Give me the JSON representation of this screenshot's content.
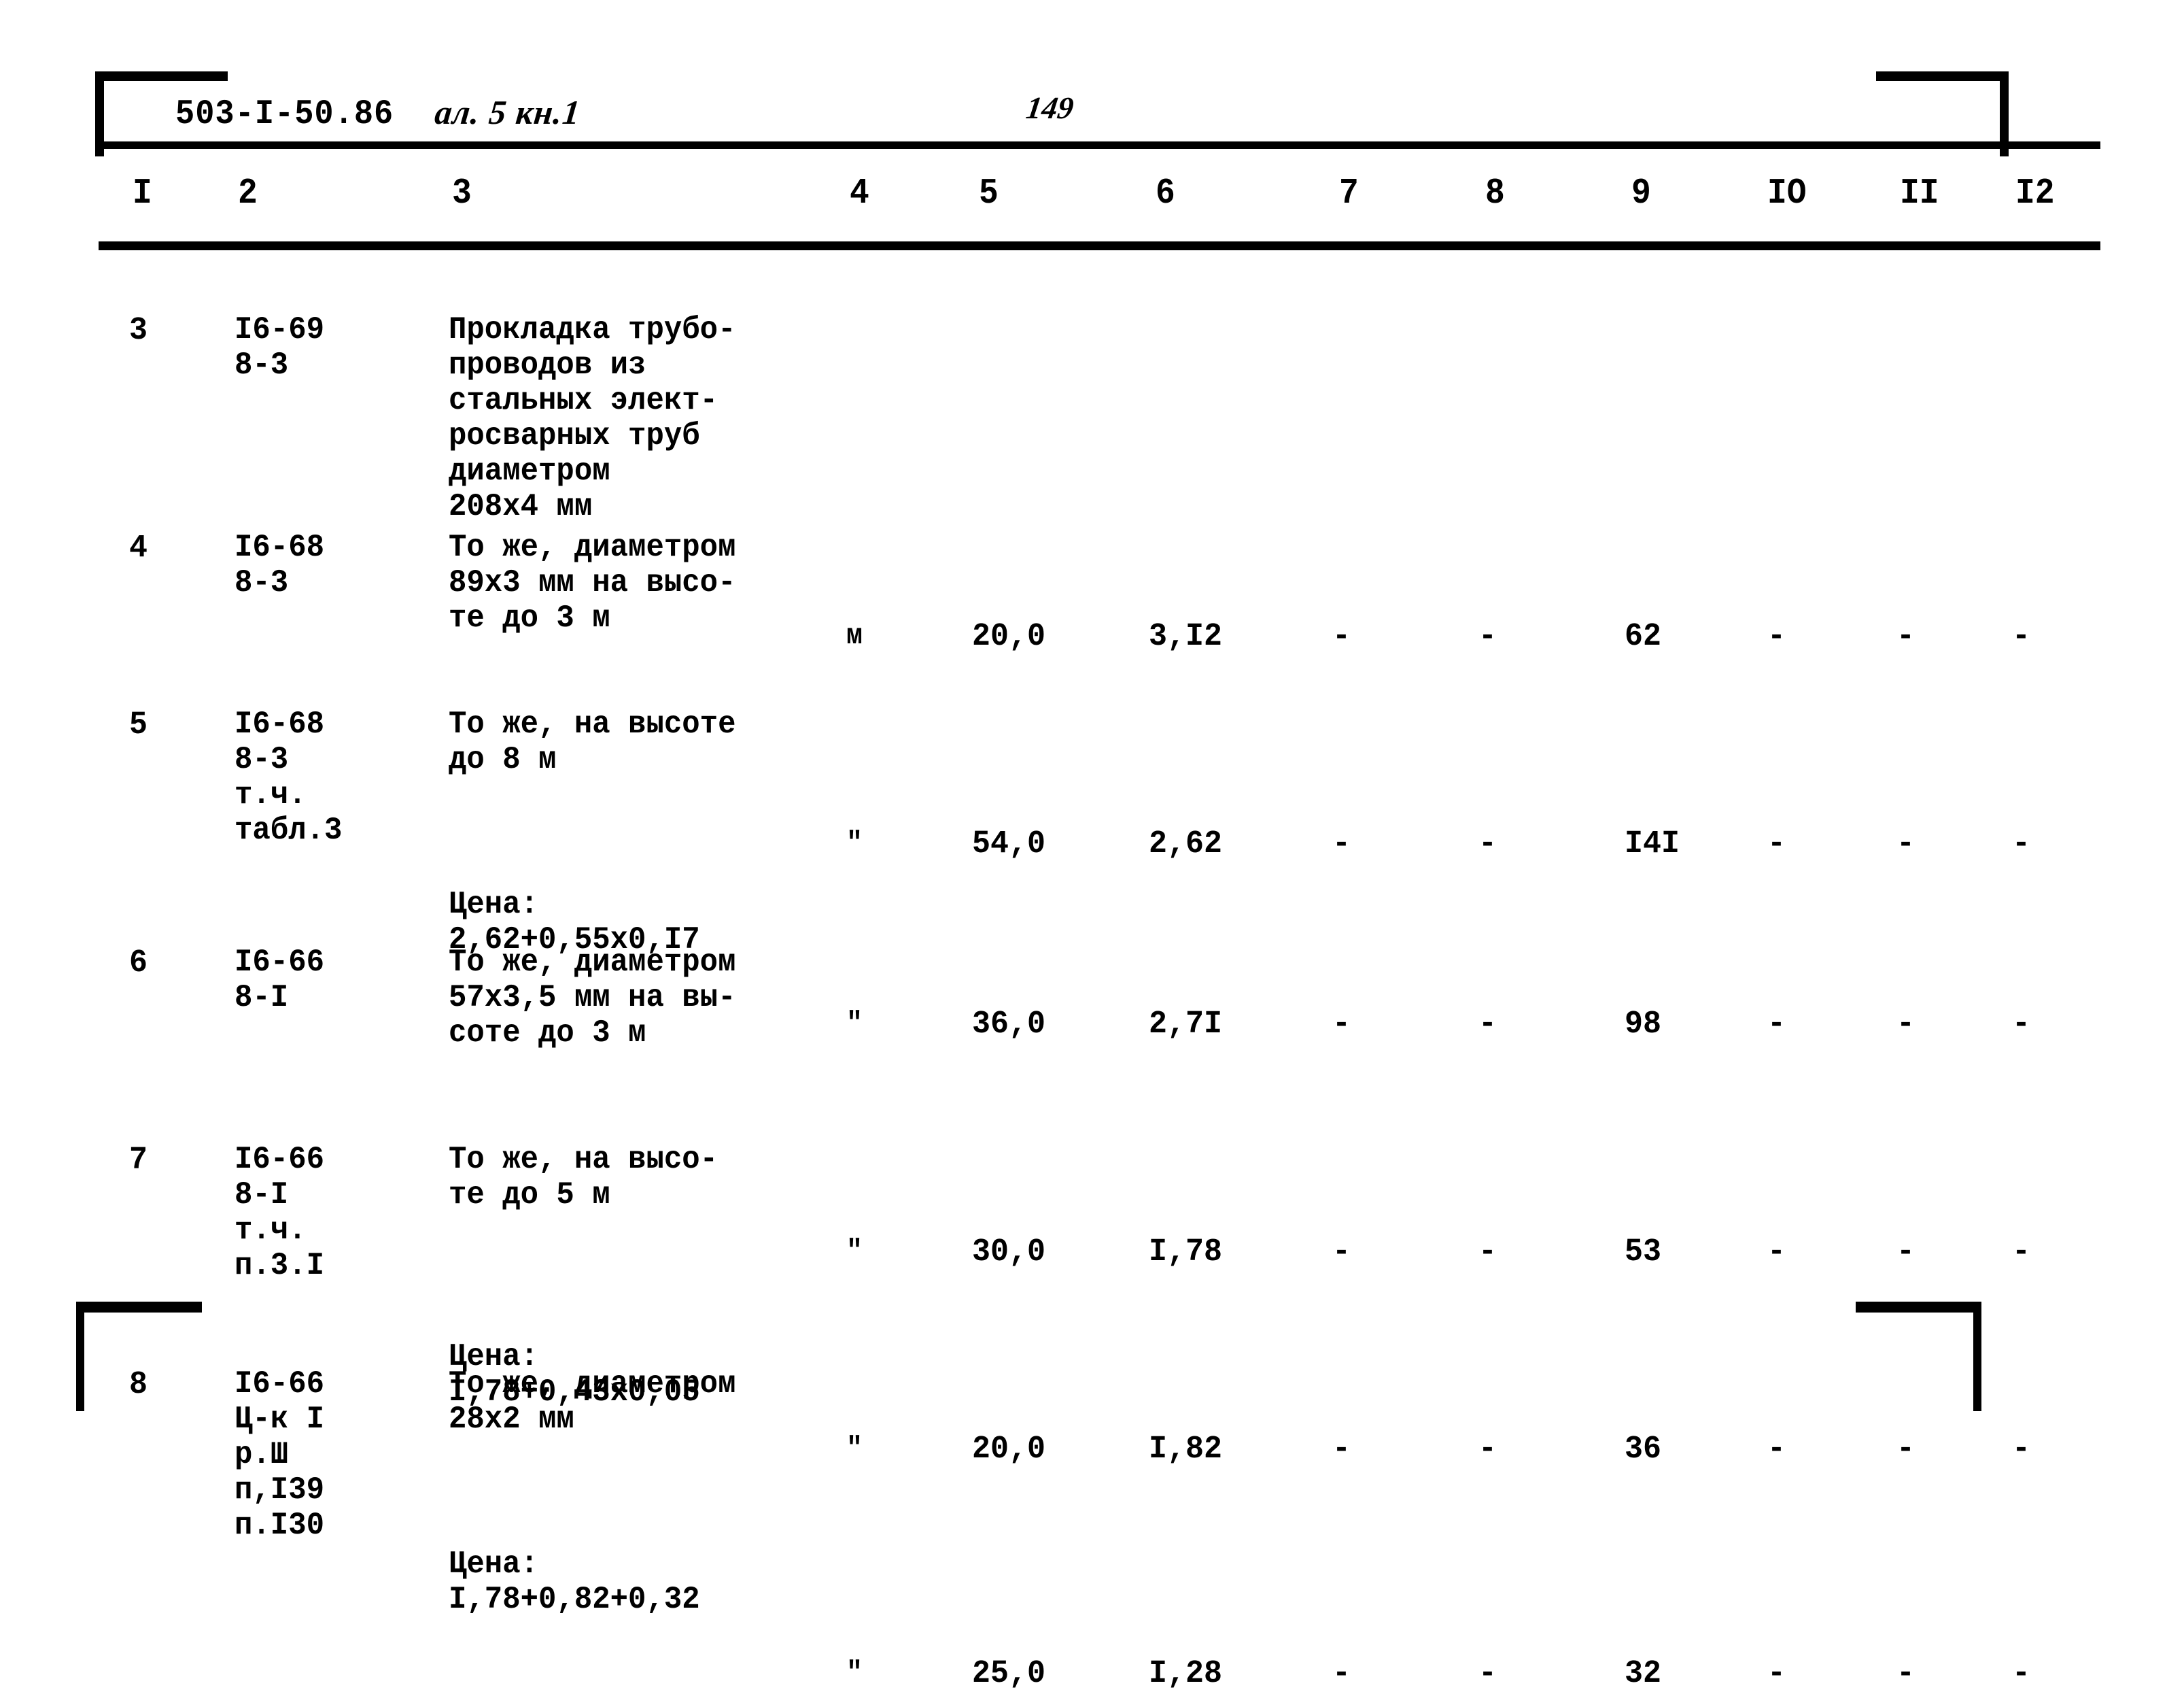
{
  "header": {
    "doc_code": "503-I-50.86",
    "handwritten_note": "ал. 5 кн.1",
    "page_number": "149"
  },
  "table": {
    "column_headers": [
      "I",
      "2",
      "3",
      "4",
      "5",
      "6",
      "7",
      "8",
      "9",
      "IO",
      "II",
      "I2"
    ],
    "rows": [
      {
        "no": "3",
        "code_lines": [
          "I6-69",
          "8-3"
        ],
        "description_lines": [
          "Прокладка трубо-",
          "проводов из",
          "стальных элект-",
          "росварных труб",
          "диаметром",
          "208х4 мм"
        ],
        "note_lines": [],
        "unit": "м",
        "c5": "20,0",
        "c6": "3,I2",
        "c7": "-",
        "c8": "-",
        "c9": "62",
        "c10": "-",
        "c11": "-",
        "c12": "-"
      },
      {
        "no": "4",
        "code_lines": [
          "I6-68",
          "8-3"
        ],
        "description_lines": [
          "То же, диаметром",
          "89х3 мм на высо-",
          "те до 3 м"
        ],
        "note_lines": [],
        "unit": "\"",
        "c5": "54,0",
        "c6": "2,62",
        "c7": "-",
        "c8": "-",
        "c9": "I4I",
        "c10": "-",
        "c11": "-",
        "c12": "-"
      },
      {
        "no": "5",
        "code_lines": [
          "I6-68",
          "8-3",
          "т.ч.",
          "табл.3"
        ],
        "description_lines": [
          "То же, на высоте",
          "до 8 м"
        ],
        "note_lines": [
          "Цена:",
          "2,62+0,55х0,I7"
        ],
        "unit": "\"",
        "c5": "36,0",
        "c6": "2,7I",
        "c7": "-",
        "c8": "-",
        "c9": "98",
        "c10": "-",
        "c11": "-",
        "c12": "-"
      },
      {
        "no": "6",
        "code_lines": [
          "I6-66",
          "8-I"
        ],
        "description_lines": [
          "То же, диаметром",
          "57х3,5 мм на вы-",
          "соте до 3 м"
        ],
        "note_lines": [],
        "unit": "\"",
        "c5": "30,0",
        "c6": "I,78",
        "c7": "-",
        "c8": "-",
        "c9": "53",
        "c10": "-",
        "c11": "-",
        "c12": "-"
      },
      {
        "no": "7",
        "code_lines": [
          "I6-66",
          "8-I",
          "т.ч.",
          "п.3.I"
        ],
        "description_lines": [
          "То же, на высо-",
          "те до 5 м"
        ],
        "note_lines": [
          "Цена:",
          "I,78+0,43х0,05"
        ],
        "unit": "\"",
        "c5": "20,0",
        "c6": "I,82",
        "c7": "-",
        "c8": "-",
        "c9": "36",
        "c10": "-",
        "c11": "-",
        "c12": "-"
      },
      {
        "no": "8",
        "code_lines": [
          "I6-66",
          "Ц-к I",
          "р.Ш",
          "п,I39",
          "п.I30"
        ],
        "description_lines": [
          "То же, диаметром",
          "28х2 мм"
        ],
        "note_lines": [
          "Цена:",
          "I,78+0,82+0,32"
        ],
        "unit": "\"",
        "c5": "25,0",
        "c6": "I,28",
        "c7": "-",
        "c8": "-",
        "c9": "32",
        "c10": "-",
        "c11": "-",
        "c12": "-"
      }
    ]
  }
}
